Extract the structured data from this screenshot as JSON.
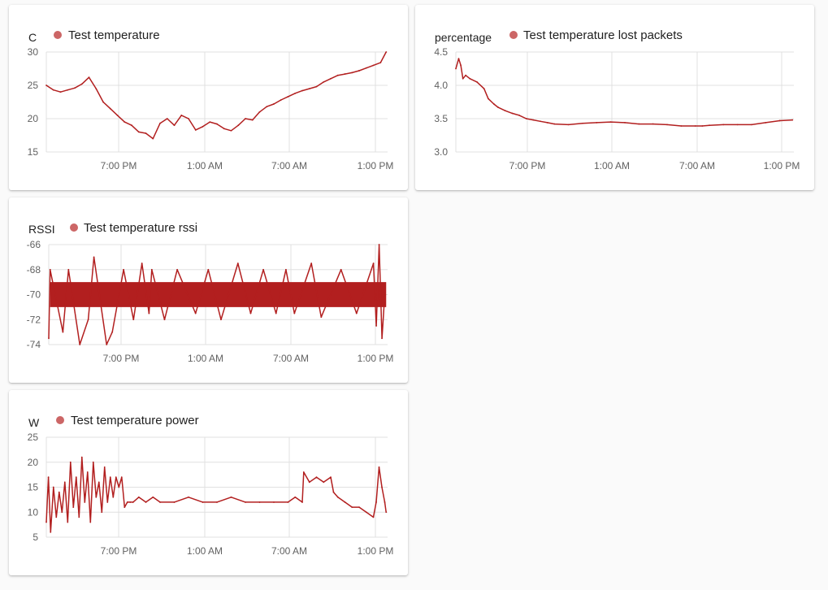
{
  "colors": {
    "series": "#b21f1f",
    "legend_dot": "#cc6666",
    "grid": "#e0e0e0",
    "card": "#ffffff",
    "background": "#fafafa"
  },
  "chart_data": [
    {
      "id": "temperature",
      "type": "line",
      "unit": "C",
      "series": [
        {
          "name": "Test temperature"
        }
      ],
      "yticks": [
        "30",
        "25",
        "20",
        "15"
      ],
      "ylim": [
        15,
        30
      ],
      "xticks": [
        "7:00 PM",
        "1:00 AM",
        "7:00 AM",
        "1:00 PM"
      ],
      "x_hours": [
        0,
        0.5,
        1,
        1.5,
        2,
        2.5,
        3,
        3.5,
        4,
        4.5,
        5,
        5.5,
        6,
        6.5,
        7,
        7.5,
        8,
        8.5,
        9,
        9.5,
        10,
        10.5,
        11,
        11.5,
        12,
        12.5,
        13,
        13.5,
        14,
        14.5,
        15,
        15.5,
        16,
        16.5,
        17,
        17.5,
        18,
        18.5,
        19,
        19.5,
        20,
        20.5,
        21,
        21.5,
        22,
        22.5,
        23,
        23.5,
        23.9
      ],
      "y": [
        25,
        24.3,
        24,
        24.3,
        24.6,
        25.2,
        26.2,
        24.5,
        22.5,
        21.5,
        20.5,
        19.5,
        19,
        18,
        17.8,
        17,
        19.3,
        20,
        19,
        20.5,
        20,
        18.3,
        18.8,
        19.5,
        19.2,
        18.5,
        18.2,
        19,
        20,
        19.8,
        21,
        21.8,
        22.2,
        22.8,
        23.3,
        23.8,
        24.2,
        24.5,
        24.8,
        25.5,
        26,
        26.5,
        26.7,
        26.9,
        27.2,
        27.6,
        28,
        28.4,
        30
      ],
      "grid": true,
      "legend": "top"
    },
    {
      "id": "lost_packets",
      "type": "line",
      "unit": "percentage",
      "series": [
        {
          "name": "Test temperature lost packets"
        }
      ],
      "yticks": [
        "4.5",
        "4.0",
        "3.5",
        "3.0"
      ],
      "ylim": [
        3.0,
        4.5
      ],
      "xticks": [
        "7:00 PM",
        "1:00 AM",
        "7:00 AM",
        "1:00 PM"
      ],
      "x_hours": [
        0,
        0.2,
        0.35,
        0.5,
        0.7,
        1,
        1.5,
        2,
        2.3,
        2.7,
        3,
        3.5,
        4,
        4.5,
        5,
        5.5,
        6,
        6.5,
        7,
        8,
        9,
        10,
        11,
        12,
        13,
        14,
        15,
        16,
        17,
        17.5,
        18,
        19,
        20,
        21,
        22,
        23,
        23.9
      ],
      "y": [
        4.25,
        4.4,
        4.3,
        4.1,
        4.15,
        4.1,
        4.05,
        3.95,
        3.8,
        3.72,
        3.67,
        3.62,
        3.58,
        3.55,
        3.5,
        3.48,
        3.46,
        3.44,
        3.42,
        3.41,
        3.43,
        3.44,
        3.45,
        3.44,
        3.42,
        3.42,
        3.41,
        3.39,
        3.39,
        3.39,
        3.4,
        3.41,
        3.41,
        3.41,
        3.44,
        3.47,
        3.48
      ],
      "grid": true,
      "legend": "top"
    },
    {
      "id": "rssi",
      "type": "line",
      "unit": "RSSI",
      "series": [
        {
          "name": "Test temperature rssi"
        }
      ],
      "yticks": [
        "-66",
        "-68",
        "-70",
        "-72",
        "-74"
      ],
      "ylim": [
        -74,
        -66
      ],
      "xticks": [
        "7:00 PM",
        "1:00 AM",
        "7:00 AM",
        "1:00 PM"
      ],
      "band": [
        -71,
        -69
      ],
      "x_hours": [
        0,
        0.1,
        1,
        1.4,
        2.2,
        2.8,
        3.2,
        4.1,
        4.5,
        5.3,
        6,
        6.6,
        7.1,
        7.3,
        8.2,
        9.1,
        10.4,
        11.3,
        12.2,
        13.4,
        14.3,
        15.2,
        16.1,
        16.8,
        17.4,
        18.6,
        19.3,
        20.7,
        21.8,
        23,
        23.2,
        23.4,
        23.6,
        23.8
      ],
      "y": [
        -73.5,
        -68,
        -73,
        -68,
        -74,
        -72,
        -67,
        -74,
        -73,
        -68,
        -72,
        -67.5,
        -71.5,
        -68,
        -72,
        -68,
        -71.5,
        -68,
        -72,
        -67.5,
        -71.5,
        -68,
        -71.5,
        -68,
        -71.5,
        -67.5,
        -71.8,
        -68,
        -71.5,
        -67.5,
        -72.5,
        -66,
        -73.5,
        -70
      ],
      "grid": true,
      "legend": "top"
    },
    {
      "id": "power",
      "type": "line",
      "unit": "W",
      "series": [
        {
          "name": "Test temperature power"
        }
      ],
      "yticks": [
        "25",
        "20",
        "15",
        "10",
        "5"
      ],
      "ylim": [
        5,
        25
      ],
      "xticks": [
        "7:00 PM",
        "1:00 AM",
        "7:00 AM",
        "1:00 PM"
      ],
      "x_hours": [
        0,
        0.15,
        0.3,
        0.5,
        0.7,
        0.9,
        1.1,
        1.3,
        1.5,
        1.7,
        1.9,
        2.1,
        2.3,
        2.5,
        2.7,
        2.9,
        3.1,
        3.3,
        3.5,
        3.7,
        3.9,
        4.1,
        4.3,
        4.5,
        4.7,
        4.9,
        5.1,
        5.3,
        5.5,
        5.7,
        5.9,
        6.1,
        6.5,
        7,
        7.5,
        8,
        9,
        10,
        11,
        12,
        13,
        14,
        15,
        16,
        17,
        17.5,
        18,
        18.1,
        18.5,
        19,
        19.5,
        20,
        20.2,
        20.5,
        21,
        21.5,
        22,
        22.5,
        23,
        23.2,
        23.4,
        23.6,
        23.8,
        23.9
      ],
      "y": [
        8,
        17,
        6,
        15,
        9,
        14,
        10,
        16,
        8,
        20,
        11,
        17,
        9,
        21,
        12,
        18,
        8,
        20,
        13,
        16,
        10,
        19,
        12,
        17,
        13,
        17,
        15,
        17,
        11,
        12,
        12,
        12,
        13,
        12,
        13,
        12,
        12,
        13,
        12,
        12,
        13,
        12,
        12,
        12,
        12,
        13,
        12,
        18,
        16,
        17,
        16,
        17,
        14,
        13,
        12,
        11,
        11,
        10,
        9,
        12,
        19,
        15,
        12,
        10
      ],
      "grid": true,
      "legend": "top"
    }
  ]
}
